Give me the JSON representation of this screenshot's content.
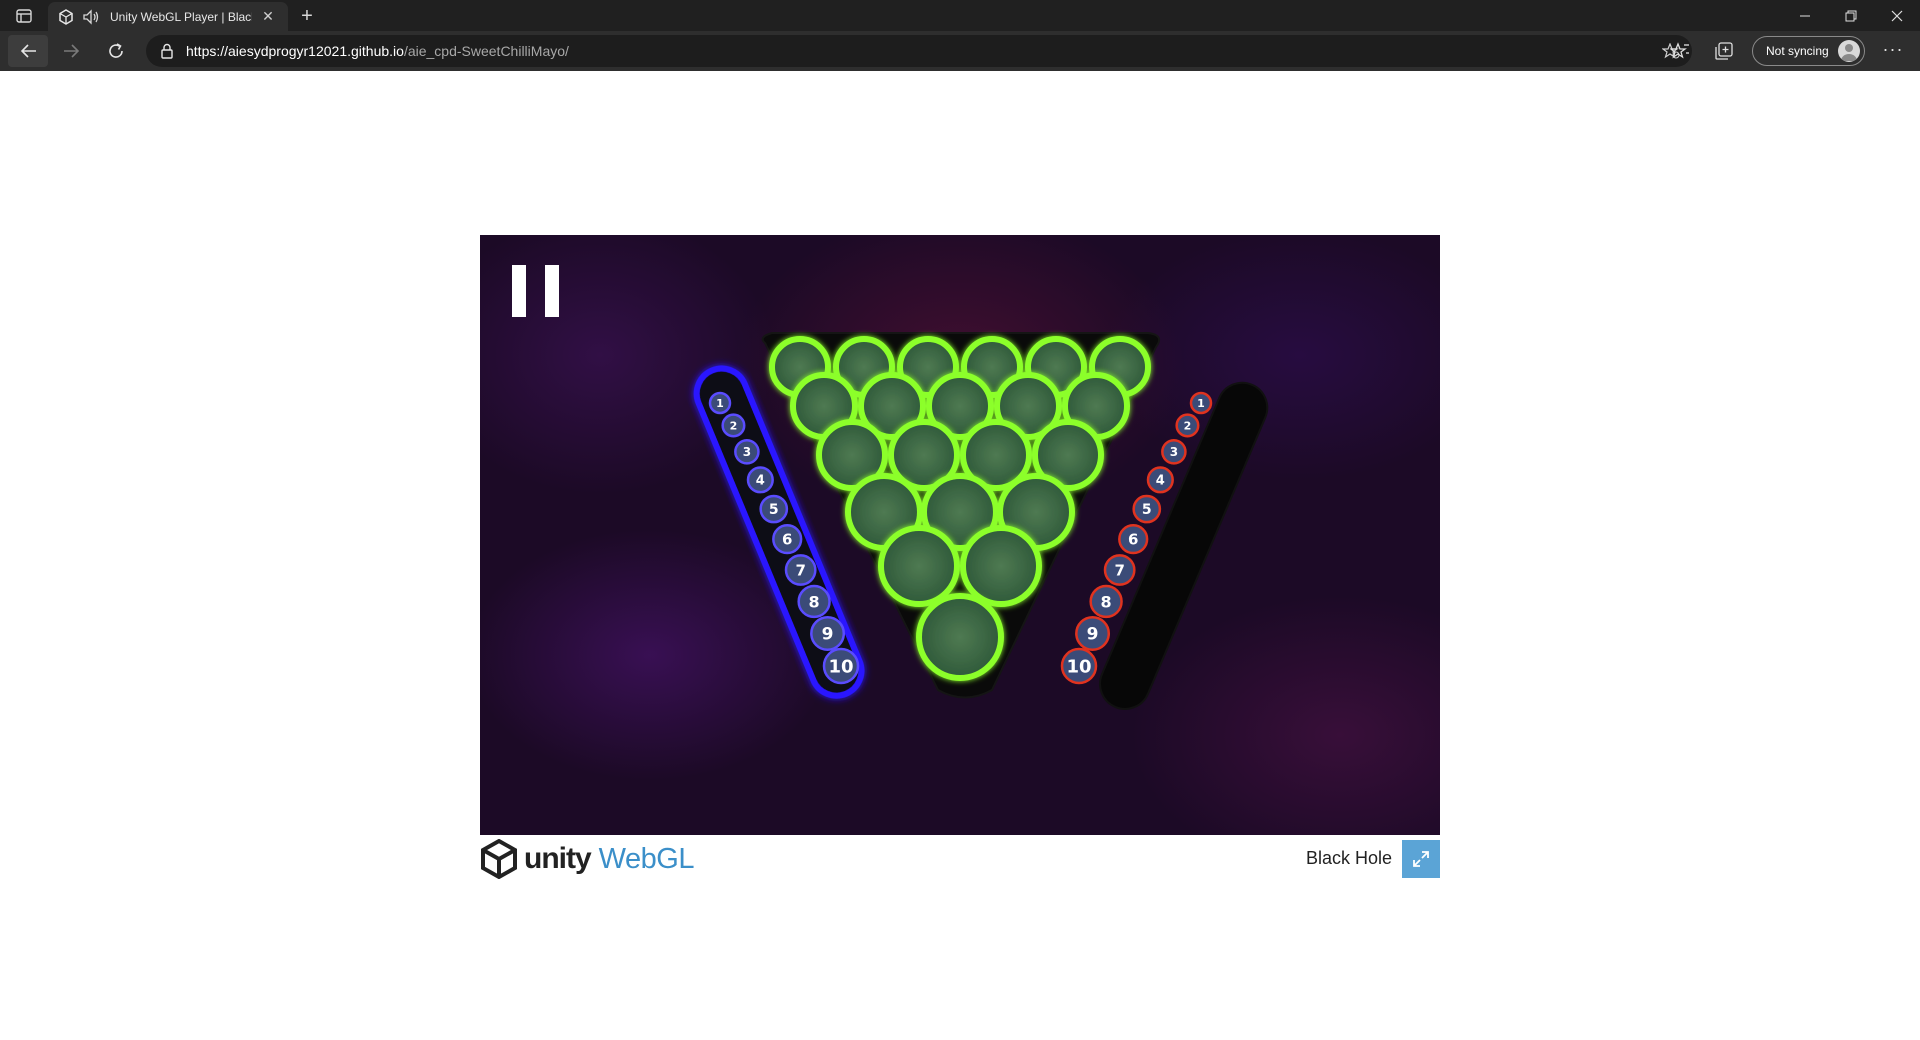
{
  "browser": {
    "tab_title": "Unity WebGL Player | Black",
    "tab_close": "✕",
    "new_tab": "+",
    "url_host": "https://aiesydprogyr12021.github.io",
    "url_path": "/aie_cpd-SweetChilliMayo/",
    "sync_label": "Not syncing",
    "more_label": "···"
  },
  "game": {
    "title": "Black Hole",
    "blue_tokens": [
      "1",
      "2",
      "3",
      "4",
      "5",
      "6",
      "7",
      "8",
      "9",
      "10"
    ],
    "red_tokens": [
      "1",
      "2",
      "3",
      "4",
      "5",
      "6",
      "7",
      "8",
      "9",
      "10"
    ],
    "board_rows": [
      6,
      5,
      4,
      3,
      2,
      1
    ],
    "colors": {
      "board_glow": "#8cff2a",
      "blue_player": "#2a18ff",
      "red_player": "#e0331f",
      "token_fill": "#3b4b78"
    }
  },
  "footer": {
    "brand_word": "unity",
    "brand_product": "WebGL"
  }
}
